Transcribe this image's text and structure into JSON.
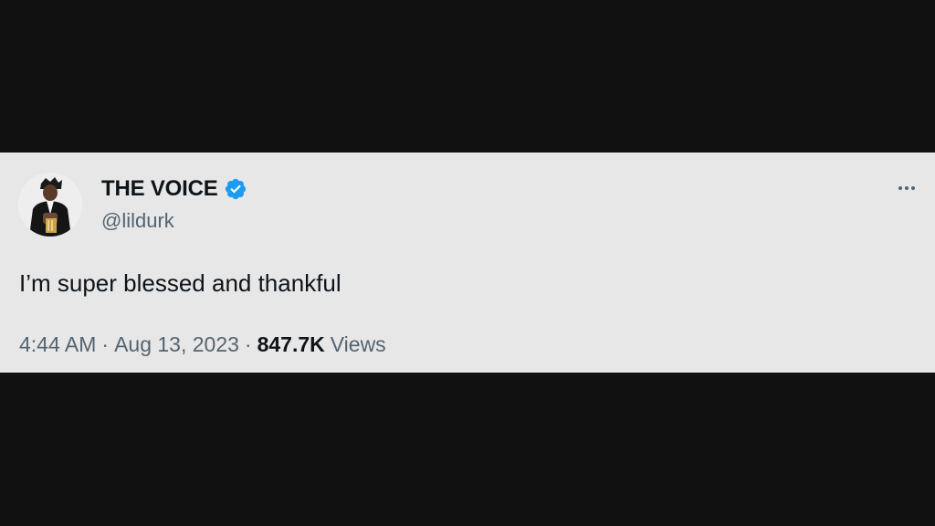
{
  "tweet": {
    "display_name": "THE VOICE",
    "handle": "@lildurk",
    "verified": true,
    "verified_icon": "verified-badge-icon",
    "text": "I’m super blessed and thankful",
    "time": "4:44 AM",
    "separator": "·",
    "date": "Aug 13, 2023",
    "views_count": "847.7K",
    "views_label": "Views",
    "more_icon": "more-horizontal-icon"
  },
  "colors": {
    "background": "#111111",
    "card": "#e7e7e7",
    "text_primary": "#0f1419",
    "text_secondary": "#536471",
    "verified": "#1d9bf0"
  }
}
